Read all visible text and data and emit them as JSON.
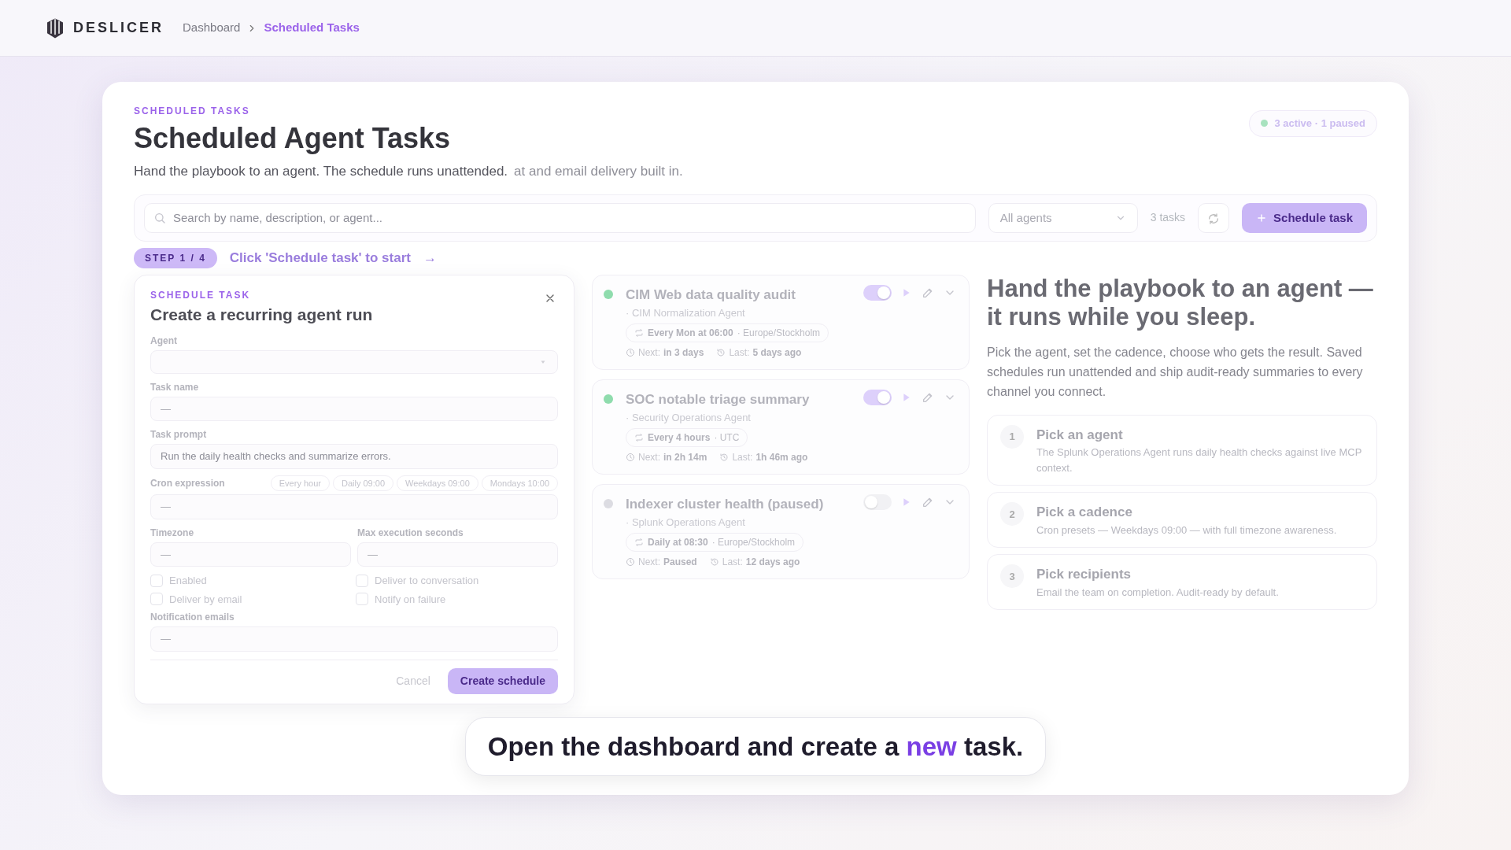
{
  "brand": {
    "name": "DESLICER"
  },
  "breadcrumb": [
    {
      "label": "Dashboard",
      "selected": false
    },
    {
      "label": "Scheduled Tasks",
      "selected": true
    }
  ],
  "header": {
    "eyebrow": "SCHEDULED TASKS",
    "title": "Scheduled Agent Tasks",
    "subtitle": "Hand the playbook to an agent. The schedule runs unattended.",
    "subtitle_faded": "at and email delivery built in.",
    "status": "3 active · 1 paused"
  },
  "toolbar": {
    "search_placeholder": "Search by name, description, or agent...",
    "agent_filter": "All agents",
    "count": "3 tasks",
    "action": "Schedule task"
  },
  "step_banner": {
    "step": "STEP 1 / 4",
    "hint": "Click 'Schedule task' to start",
    "arrow": "→"
  },
  "modal": {
    "eyebrow": "SCHEDULE TASK",
    "title": "Create a recurring agent run",
    "agent": {
      "label": "Agent"
    },
    "task_name": {
      "label": "Task name",
      "value": "—"
    },
    "task_prompt": {
      "label": "Task prompt",
      "placeholder": "Run the daily health checks and summarize errors."
    },
    "cron": {
      "label": "Cron expression",
      "value": "—",
      "presets": [
        "Every hour",
        "Daily 09:00",
        "Weekdays 09:00",
        "Mondays 10:00"
      ]
    },
    "pair": [
      {
        "label": "Timezone",
        "value": "—"
      },
      {
        "label": "Max execution seconds",
        "value": "—"
      }
    ],
    "options": [
      {
        "label": "Enabled",
        "checked": false
      },
      {
        "label": "Deliver to conversation",
        "checked": false
      },
      {
        "label": "Deliver by email",
        "checked": false
      },
      {
        "label": "Notify on failure",
        "checked": false
      }
    ],
    "emails": {
      "label": "Notification emails",
      "value": "—"
    },
    "buttons": {
      "cancel": "Cancel",
      "create": "Create schedule"
    }
  },
  "tasks": [
    {
      "name": "CIM Web data quality audit",
      "agent": "· CIM Normalization Agent",
      "schedule": "Every Mon at 06:00",
      "timezone": "· Europe/Stockholm",
      "next_label": "Next:",
      "next": "in 3 days",
      "last_label": "Last:",
      "last": "5 days ago",
      "enabled": true,
      "color": "#8fdcad"
    },
    {
      "name": "SOC notable triage summary",
      "agent": "· Security Operations Agent",
      "schedule": "Every 4 hours",
      "timezone": "· UTC",
      "next_label": "Next:",
      "next": "in 2h 14m",
      "last_label": "Last:",
      "last": "1h 46m ago",
      "enabled": true,
      "color": "#8fdcad"
    },
    {
      "name": "Indexer cluster health (paused)",
      "agent": "· Splunk Operations Agent",
      "schedule": "Daily at 08:30",
      "timezone": "· Europe/Stockholm",
      "next_label": "Next:",
      "next": "Paused",
      "last_label": "Last:",
      "last": "12 days ago",
      "enabled": false,
      "color": "#dcdce2"
    }
  ],
  "hero": {
    "title": "Hand the playbook to an agent — it runs while you sleep.",
    "body": "Pick the agent, set the cadence, choose who gets the result. Saved schedules run unattended and ship audit-ready summaries to every channel you connect.",
    "steps": [
      {
        "number": "1",
        "title": "Pick an agent",
        "text": "The Splunk Operations Agent runs daily health checks against live MCP context."
      },
      {
        "number": "2",
        "title": "Pick a cadence",
        "text": "Cron presets — Weekdays 09:00 — with full timezone awareness."
      },
      {
        "number": "3",
        "title": "Pick recipients",
        "text": "Email the team on completion. Audit-ready by default."
      }
    ]
  },
  "caption": {
    "text": "Open the dashboard and create a **new** task."
  }
}
